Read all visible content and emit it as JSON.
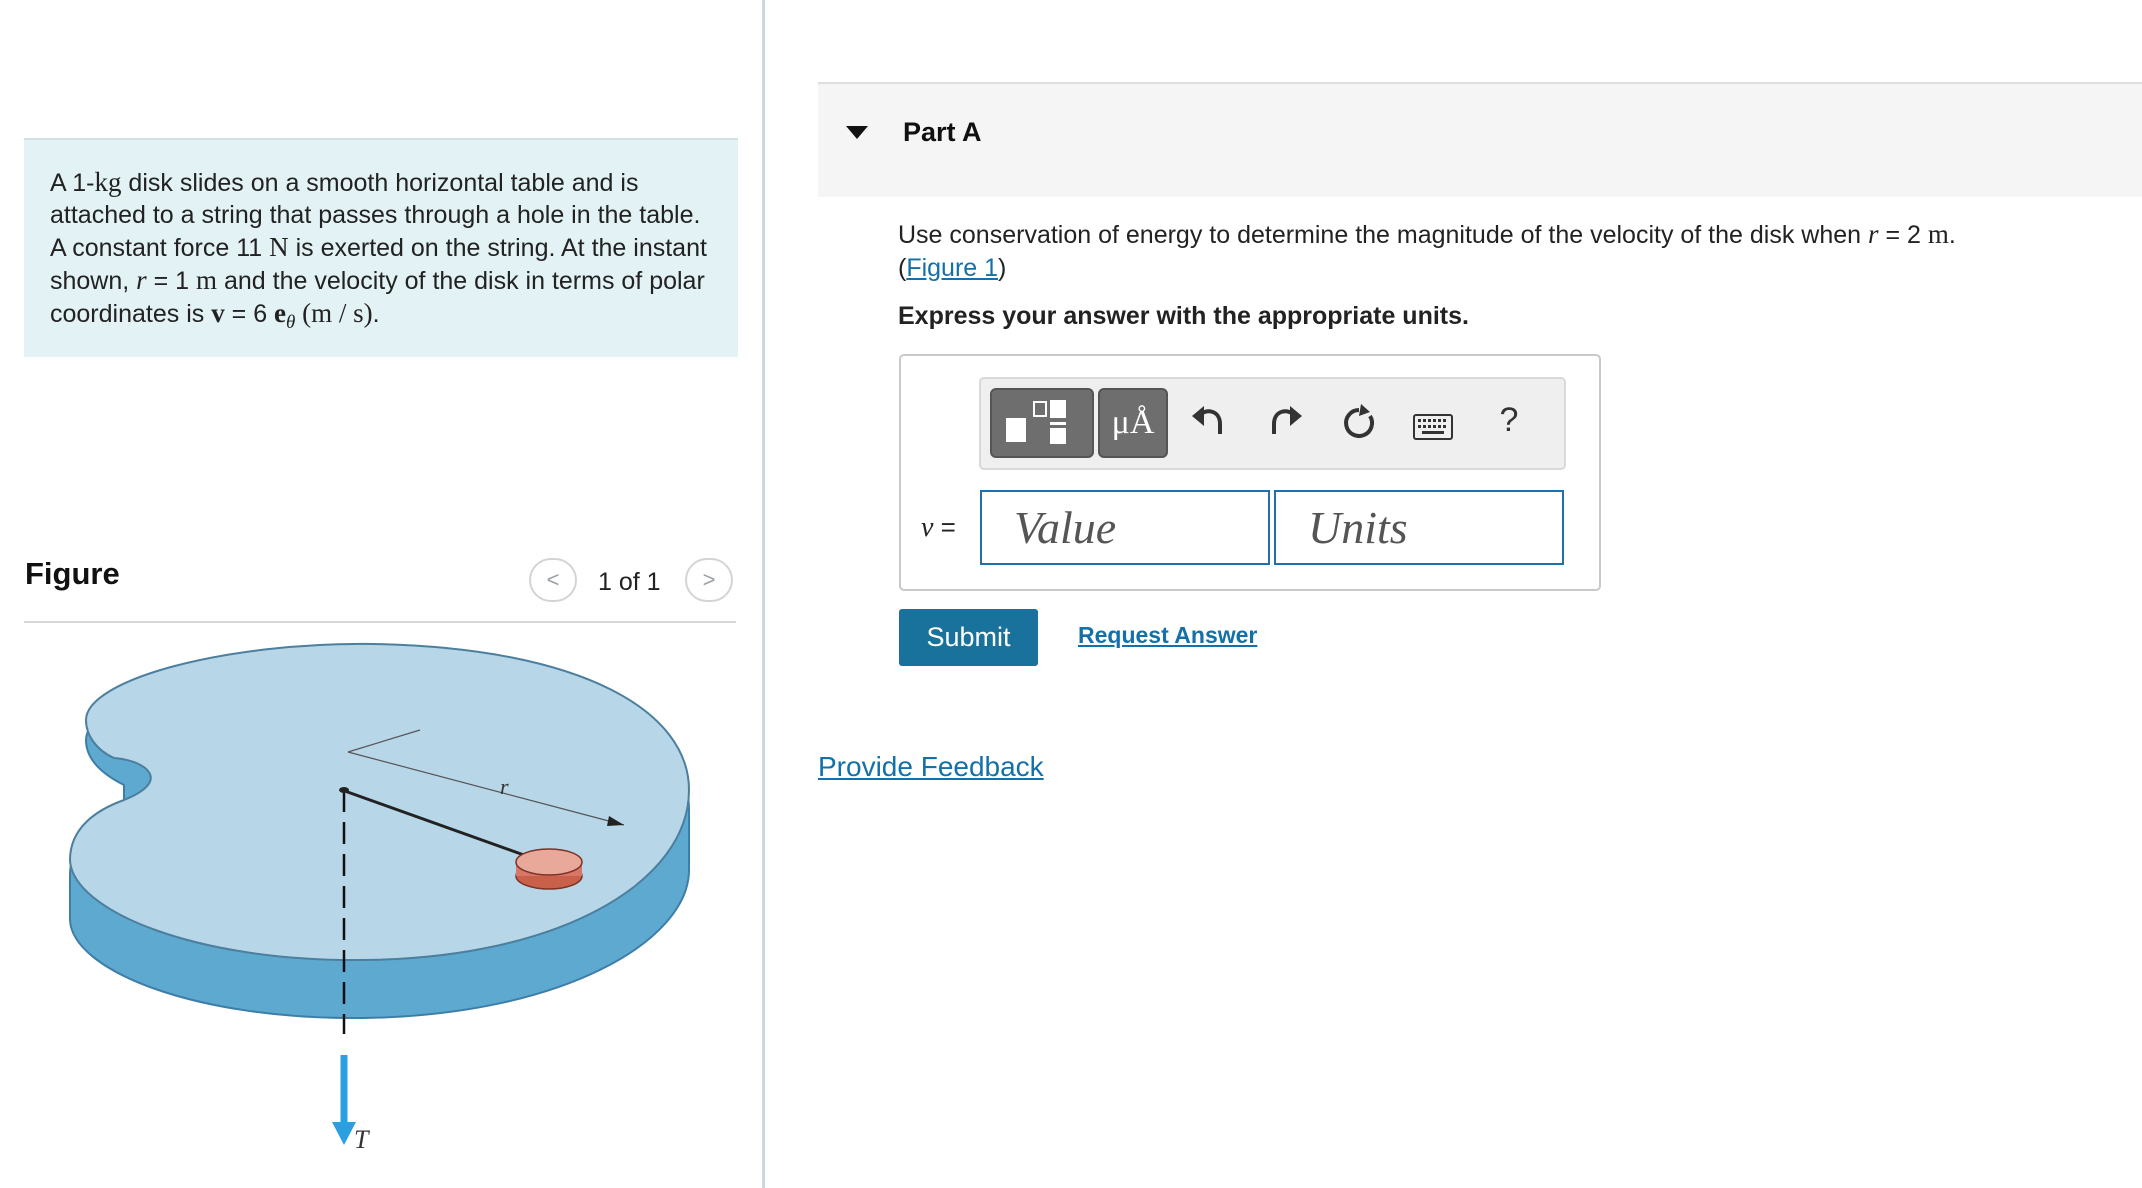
{
  "problem": {
    "t1": "A 1-",
    "m_kg": "kg",
    "t2": " disk slides on a smooth horizontal table and is attached to a string that passes through a hole in the table. A constant force 11 ",
    "m_N": "N",
    "t3": " is exerted on the string. At the instant shown, ",
    "m_r": "r",
    "t4": " = 1 ",
    "m_m": "m",
    "t5": " and the velocity of the disk in terms of polar coordinates is ",
    "m_v": "v",
    "t6": " = 6 ",
    "m_e": "e",
    "m_theta": "θ",
    "m_units": " (m / s)",
    "t7": "."
  },
  "figure_panel": {
    "title": "Figure",
    "page_indicator": "1 of 1",
    "prev_glyph": "<",
    "next_glyph": ">",
    "labels": {
      "r": "r",
      "T": "T"
    }
  },
  "part": {
    "title": "Part A",
    "q1": "Use conservation of energy to determine the magnitude of the velocity of the disk when ",
    "q_r": "r",
    "q2": " = 2 ",
    "q_m": "m",
    "q3": ".",
    "q_open": "(",
    "fig_link": "Figure 1",
    "q_close": ")",
    "express": "Express your answer with the appropriate units."
  },
  "toolbar": {
    "units_glyph": "μÅ",
    "help": "?"
  },
  "answer": {
    "variable": "v",
    "equals": " =",
    "value_placeholder": "Value",
    "units_placeholder": "Units"
  },
  "actions": {
    "submit": "Submit",
    "request_answer": "Request Answer",
    "feedback": "Provide Feedback"
  },
  "colors": {
    "accent": "#19729c",
    "link": "#1470a8",
    "panel_bg": "#e3f2f4",
    "table_top": "#b7d6e8",
    "table_side": "#5ea9cf",
    "disk": "#e8a89a"
  }
}
